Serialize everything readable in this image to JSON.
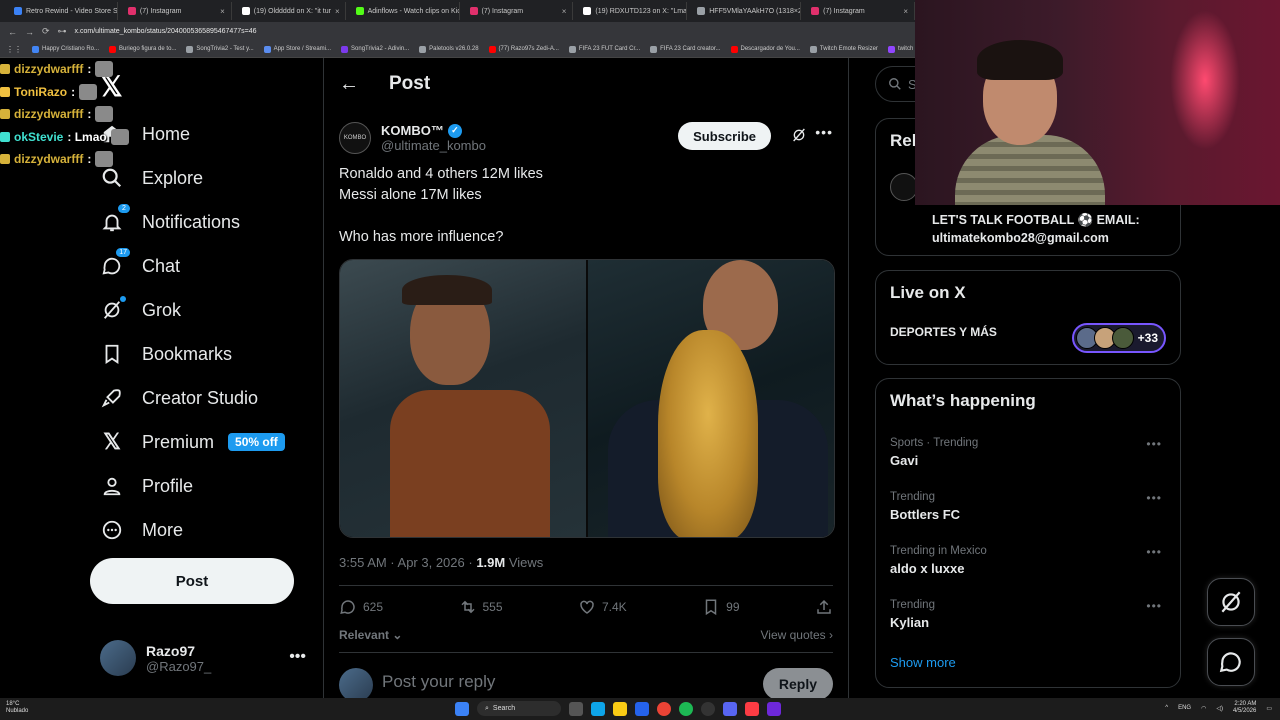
{
  "browser": {
    "tabs": [
      {
        "title": "Retro Rewind - Video Store Sim",
        "color": "#3b82f6"
      },
      {
        "title": "(7) Instagram",
        "color": "#e1306c"
      },
      {
        "title": "(19) Olddddd on X: \"it tur",
        "color": "#ffffff"
      },
      {
        "title": "Adinflows - Watch clips on Kick",
        "color": "#53fc18"
      },
      {
        "title": "(7) Instagram",
        "color": "#e1306c"
      },
      {
        "title": "(19) RDXUTD123 on X: \"Lmao",
        "color": "#ffffff"
      },
      {
        "title": "HFF5VMlaYAAkH7O (1318×20",
        "color": "#9aa0a6"
      },
      {
        "title": "(7) Instagram",
        "color": "#e1306c"
      }
    ],
    "url": "x.com/ultimate_kombo/status/2040005365895467477s=46",
    "bookmarks": [
      {
        "label": "Happy Cristiano Ro...",
        "color": "#4285f4"
      },
      {
        "label": "Buriego figura de to...",
        "color": "#ff0000"
      },
      {
        "label": "SongTrivia2 - Test y...",
        "color": "#9aa0a6"
      },
      {
        "label": "App Store / Streami...",
        "color": "#5b8def"
      },
      {
        "label": "SongTrivia2 - Adivin...",
        "color": "#7c3aed"
      },
      {
        "label": "Paletools v26.0.28",
        "color": "#9aa0a6"
      },
      {
        "label": "(77) Razo97s Zedi-A...",
        "color": "#ff0000"
      },
      {
        "label": "FIFA 23 FUT Card Cr...",
        "color": "#9aa0a6"
      },
      {
        "label": "FIFA 23 Card creator...",
        "color": "#9aa0a6"
      },
      {
        "label": "Descargador de You...",
        "color": "#ff0000"
      },
      {
        "label": "Twitch Emote Resizer",
        "color": "#9aa0a6"
      },
      {
        "label": "twitch emote re",
        "color": "#9146ff"
      }
    ]
  },
  "chat": [
    {
      "user": "dizzydwarfff",
      "color": "#d6b23a",
      "suffix": ":"
    },
    {
      "user": "ToniRazo",
      "color": "#f0c040",
      "suffix": ":"
    },
    {
      "user": "dizzydwarfff",
      "color": "#d6b23a",
      "suffix": ":"
    },
    {
      "user": "okStevie",
      "color": "#40e0d0",
      "suffix": ": Lmao"
    },
    {
      "user": "dizzydwarfff",
      "color": "#d6b23a",
      "suffix": ":"
    }
  ],
  "nav": {
    "home": "Home",
    "explore": "Explore",
    "notifications": "Notifications",
    "notifications_badge": "2",
    "chat": "Chat",
    "chat_badge": "17",
    "grok": "Grok",
    "bookmarks": "Bookmarks",
    "creator_studio": "Creator Studio",
    "premium": "Premium",
    "premium_pill": "50% off",
    "profile": "Profile",
    "more": "More",
    "post_button": "Post"
  },
  "account": {
    "name": "Razo97",
    "handle": "@Razo97_"
  },
  "main": {
    "title": "Post",
    "author_name": "KOMBO™",
    "author_handle": "@ultimate_kombo",
    "subscribe": "Subscribe",
    "text_line1": "Ronaldo and 4 others 12M likes",
    "text_line2": "Messi alone 17M likes",
    "text_line3": "Who has more influence?",
    "time": "3:55 AM · Apr 3, 2026 · ",
    "views_count": "1.9M",
    "views_label": " Views",
    "replies": "625",
    "reposts": "555",
    "likes": "7.4K",
    "bookmarks": "99",
    "relevant": "Relevant",
    "view_quotes": "View quotes",
    "reply_placeholder": "Post your reply",
    "reply_button": "Reply"
  },
  "right": {
    "search_placeholder": "Se",
    "relevant_title": "Rel",
    "bio_line1": "LET'S TALK FOOTBALL ⚽ EMAIL:",
    "bio_line2": "ultimatekombo28@gmail.com",
    "live_title": "Live on X",
    "live_sub": "DEPORTES Y MÁS",
    "live_count": "+33",
    "happening_title": "What’s happening",
    "trends": [
      {
        "meta": "Sports · Trending",
        "name": "Gavi"
      },
      {
        "meta": "Trending",
        "name": "Bottlers FC"
      },
      {
        "meta": "Trending in Mexico",
        "name": "aldo x luxxe"
      },
      {
        "meta": "Trending",
        "name": "Kylian"
      }
    ],
    "show_more": "Show more"
  },
  "taskbar": {
    "temp": "18°C",
    "weather": "Nublado",
    "search": "Search",
    "lang": "ENG",
    "time": "2:20 AM",
    "date": "4/5/2026"
  },
  "icons": {
    "x_logo": "𝕏",
    "home": "home-icon",
    "explore": "search-icon",
    "notifications": "bell-icon",
    "chat": "chat-icon",
    "grok": "grok-icon",
    "bookmarks": "bookmark-icon",
    "creator_studio": "rocket-icon",
    "premium": "x-icon",
    "profile": "person-icon",
    "more": "more-circle-icon"
  }
}
